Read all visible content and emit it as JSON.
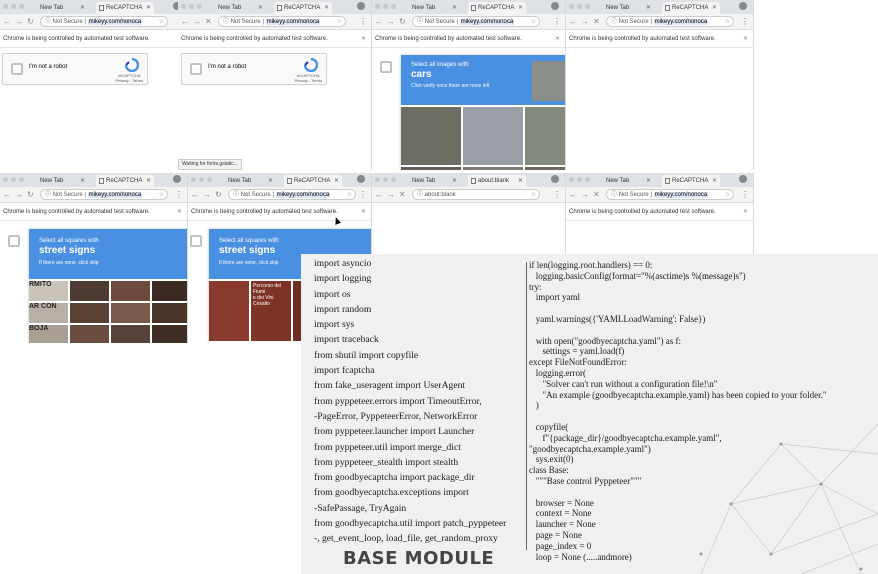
{
  "browser": {
    "tab_new": "New Tab",
    "tab_recaptcha": "ReCAPTCHA",
    "tab_blank": "about:blank",
    "not_secure": "Not Secure",
    "host": "mikeyy.com/nonoca",
    "blank_url": "about:blank",
    "infobar": "Chrome is being controlled by automated test software.",
    "status_waiting": "Waiting for fonts.gstatic..."
  },
  "recaptcha": {
    "label": "I'm not a robot",
    "brand": "reCAPTCHA",
    "links": "Privacy - Terms",
    "challenge_cars": {
      "line1": "Select all images with",
      "line2": "cars",
      "line3": "Click verify once there are none left"
    },
    "challenge_signs": {
      "line1": "Select all squares with",
      "line2": "street signs",
      "line3": "If there are none, click skip"
    },
    "sign_text": [
      "Percorso dei Fiumi",
      "e dei Vini",
      "Cesalto"
    ],
    "sign_text2": [
      "RMITO",
      "AR CON",
      "BOJA"
    ]
  },
  "code_left": [
    "import asyncio",
    "import logging",
    "import os",
    "import random",
    "import sys",
    "import traceback",
    "from shutil import copyfile",
    "import fcaptcha",
    "from fake_useragent import UserAgent",
    "from pyppeteer.errors import TimeoutError,",
    "-PageError, PyppeteerError, NetworkError",
    "from pyppeteer.launcher import Launcher",
    "from pyppeteer.util import merge_dict",
    "from pyppeteer_stealth import stealth",
    "from goodbyecaptcha import package_dir",
    "from goodbyecaptcha.exceptions import",
    "-SafePassage, TryAgain",
    "from goodbyecaptcha.util import patch_pyppeteer",
    "-, get_event_loop, load_file, get_random_proxy"
  ],
  "code_right": [
    "if len(logging.root.handlers) == 0:",
    "   logging.basicConfig(format=\"%(asctime)s %(message)s\")",
    "try:",
    "   import yaml",
    "",
    "   yaml.warnings({'YAMLLoadWarning': False})",
    "",
    "   with open(\"goodbyecaptcha.yaml\") as f:",
    "      settings = yaml.load(f)",
    "except FileNotFoundError:",
    "   logging.error(",
    "      \"Solver can't run without a configuration file!\\n\"",
    "      \"An example (goodbyecaptcha.example.yaml) has been copied to your folder.\"",
    "   )",
    "",
    "   copyfile(",
    "      f\"{package_dir}/goodbyecaptcha.example.yaml\",",
    "\"goodbyecaptcha.example.yaml\")",
    "   sys.exit(0)",
    "class Base:",
    "   \"\"\"Base control Pyppeteer\"\"\"",
    "",
    "   browser = None",
    "   context = None",
    "   launcher = None",
    "   page = None",
    "   page_index = 0",
    "   loop = None (.....andmore)"
  ],
  "module_title": "BASE MODULE",
  "colors": {
    "recaptcha_blue": "#4a90e2",
    "slide_bg": "#f0f0f0",
    "tabbar": "#dee1e6"
  }
}
